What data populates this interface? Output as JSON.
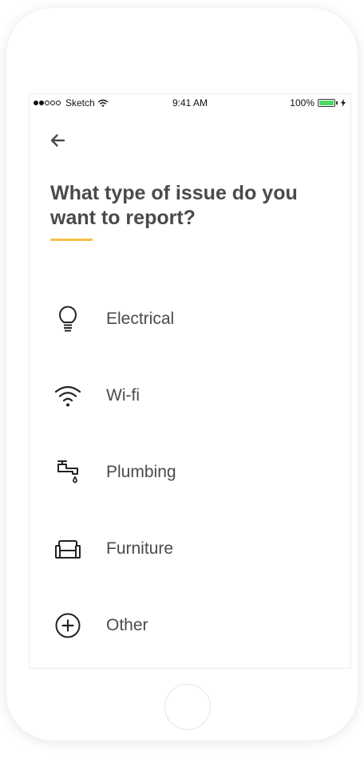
{
  "status_bar": {
    "carrier": "Sketch",
    "time": "9:41 AM",
    "battery": "100%",
    "battery_level": 1.0,
    "signal_bars_filled": 2,
    "signal_bars_total": 5,
    "wifi_icon": "wifi-icon",
    "charging_icon": "bolt-icon"
  },
  "header": {
    "back_icon": "arrow-left-icon",
    "title": "What type of issue do you want to report?",
    "accent_color": "#f5c14a"
  },
  "options": [
    {
      "label": "Electrical",
      "icon": "lightbulb-icon"
    },
    {
      "label": "Wi-fi",
      "icon": "wifi-icon"
    },
    {
      "label": "Plumbing",
      "icon": "faucet-icon"
    },
    {
      "label": "Furniture",
      "icon": "sofa-icon"
    },
    {
      "label": "Other",
      "icon": "plus-circle-icon"
    }
  ],
  "colors": {
    "text": "#4a4a4a",
    "battery_fill": "#4cd964"
  }
}
